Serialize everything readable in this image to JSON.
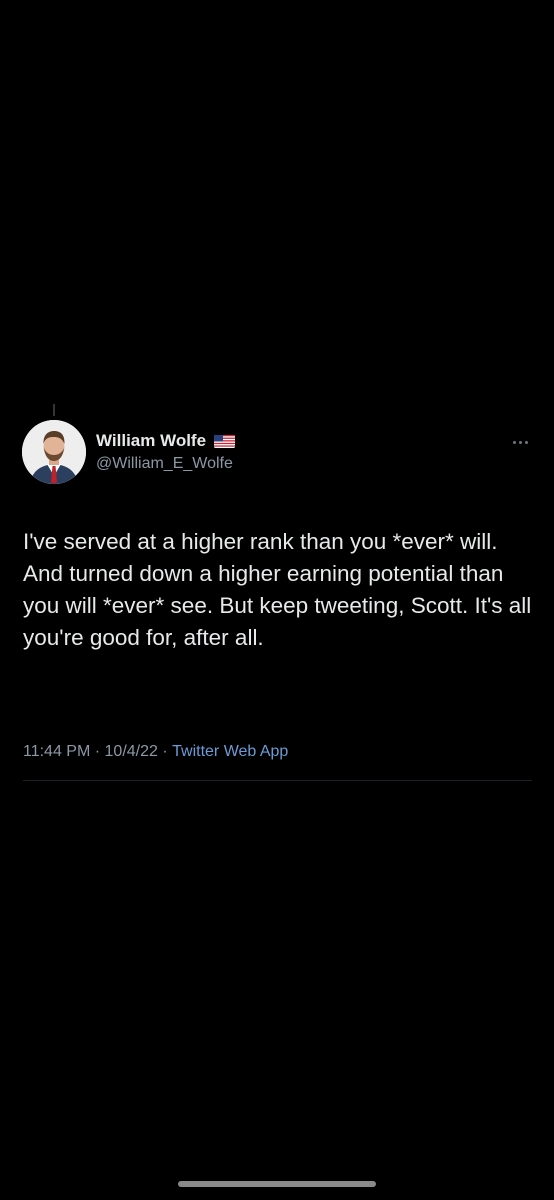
{
  "tweet": {
    "author": {
      "display_name": "William Wolfe",
      "handle": "@William_E_Wolfe",
      "badge_icon": "us-flag-icon",
      "avatar_icon": "profile-photo"
    },
    "text": "I've served at a higher rank than you *ever* will. And turned down a higher earning potential than you will *ever* see. But keep tweeting, Scott. It's all you're good for, after all.",
    "time": "11:44 PM",
    "separator": " · ",
    "date": "10/4/22",
    "source": "Twitter Web App",
    "more_icon": "more-options-icon"
  },
  "colors": {
    "background": "#000000",
    "text_primary": "#e7e9ea",
    "text_secondary": "#8b98a5",
    "link": "#6a9cd6"
  }
}
